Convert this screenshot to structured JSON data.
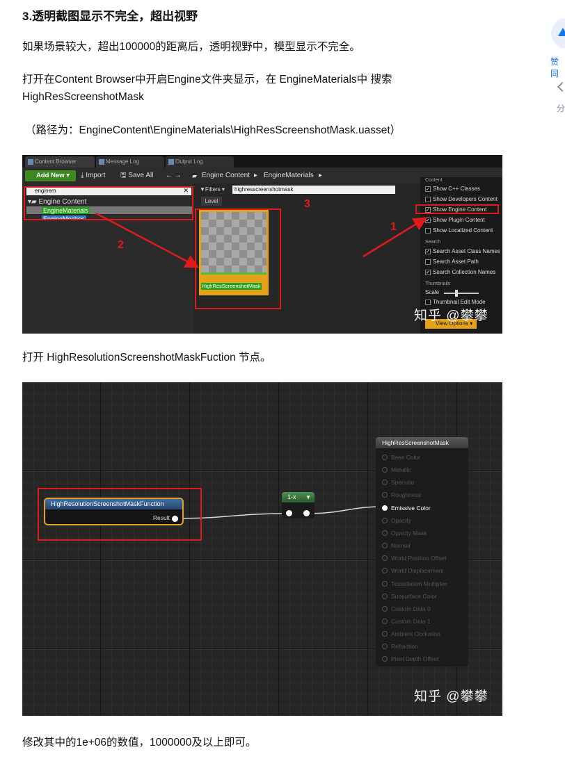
{
  "heading": "3.透明截图显示不完全，超出视野",
  "paragraphs": {
    "p1": "如果场景较大，超出100000的距离后，透明视野中，模型显示不完全。",
    "p2_line1": "打开在Content Browser中开启Engine文件夹显示，在 EngineMaterials中 搜索",
    "p2_line2": "HighResScreenshotMask",
    "p3": "（路径为：EngineContent\\EngineMaterials\\HighResScreenshotMask.uasset）",
    "p4": "打开 HighResolutionScreenshotMaskFuction 节点。",
    "p5": "修改其中的1e+06的数值，1000000及以上即可。"
  },
  "side": {
    "vote_label": "赞同",
    "share_label": "分"
  },
  "screenshot1": {
    "tabs": [
      "Content Browser",
      "Message Log",
      "Output Log"
    ],
    "toolbar": {
      "add_new": "Add New ▾",
      "import": "⤓ Import",
      "save_all": "🖫 Save All",
      "nav": "← →",
      "crumb_root": "Engine Content",
      "crumb_sep": "▸",
      "crumb_child": "EngineMaterials",
      "crumb_end": "▸"
    },
    "tree": {
      "search_value": "enginem",
      "clear": "✕",
      "root": "Engine Content",
      "item1": "EngineMaterials",
      "item2": "EngineMeshes"
    },
    "main": {
      "filters": "▼Filters ▾",
      "search_value": "highresscreenshotmask",
      "level_tab": "Level",
      "asset_label": "HighResScreenshotMask"
    },
    "view_options": {
      "content_head": "Content",
      "items": [
        {
          "label": "Show C++ Classes",
          "checked": true
        },
        {
          "label": "Show Developers Content",
          "checked": false
        },
        {
          "label": "Show Engine Content",
          "checked": true
        },
        {
          "label": "Show Plugin Content",
          "checked": true
        },
        {
          "label": "Show Localized Content",
          "checked": false
        }
      ],
      "search_head": "Search",
      "search_items": [
        {
          "label": "Search Asset Class Names",
          "checked": true
        },
        {
          "label": "Search Asset Path",
          "checked": false
        },
        {
          "label": "Search Collection Names",
          "checked": true
        }
      ],
      "thumb_head": "Thumbnails",
      "scale_label": "Scale",
      "thumb_edit": "Thumbnail Edit Mode",
      "button": "View Options ▾"
    },
    "annotations": [
      "1",
      "2",
      "3"
    ],
    "watermark": "知乎 @攀攀"
  },
  "screenshot2": {
    "fn_node": {
      "title": "HighResolutionScreenshotMaskFunction",
      "output": "Result"
    },
    "oneminus_node": {
      "title": "1-x"
    },
    "output_node": {
      "title": "HighResScreenshotMask",
      "pins": [
        "Base Color",
        "Metallic",
        "Specular",
        "Roughness",
        "Emissive Color",
        "Opacity",
        "Opacity Mask",
        "Normal",
        "World Position Offset",
        "World Displacement",
        "Tessellation Multiplier",
        "Subsurface Color",
        "Custom Data 0",
        "Custom Data 1",
        "Ambient Occlusion",
        "Refraction",
        "Pixel Depth Offset"
      ],
      "active_pin": "Emissive Color"
    },
    "watermark": "知乎 @攀攀"
  },
  "colors": {
    "annotation_red": "#e01b1b",
    "ue_selection_orange": "#e3a21a",
    "ue_green": "#3c8a1f",
    "link_blue": "#1772f6"
  }
}
